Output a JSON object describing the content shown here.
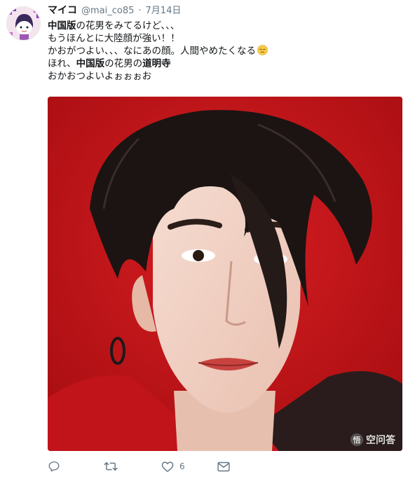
{
  "tweet": {
    "display_name": "マイコ",
    "handle": "@mai_co85",
    "separator": "·",
    "date": "7月14日",
    "lines": [
      {
        "parts": [
          {
            "t": "中国版",
            "bold": true
          },
          {
            "t": "の花男をみてるけど、、、",
            "bold": false
          }
        ]
      },
      {
        "parts": [
          {
            "t": "もうほんとに大陸顔が強い！！",
            "bold": false
          }
        ]
      },
      {
        "parts": [
          {
            "t": "かおがつよい、、、なにあの顔。人間やめたくなる",
            "bold": false
          }
        ]
      },
      {
        "parts": [
          {
            "t": "ほれ、",
            "bold": false
          },
          {
            "t": "中国版",
            "bold": true
          },
          {
            "t": "の花男の",
            "bold": false
          },
          {
            "t": "道明寺",
            "bold": true
          }
        ]
      },
      {
        "parts": [
          {
            "t": "おかおつよいよぉぉぉお",
            "bold": false
          }
        ]
      }
    ],
    "emoji_icon": "pensive-face-emoji"
  },
  "actions": {
    "reply_icon": "reply-icon",
    "retweet_icon": "retweet-icon",
    "like_icon": "heart-icon",
    "like_count": "6",
    "dm_icon": "envelope-icon"
  },
  "watermark": {
    "badge": "悟",
    "text": "空问答"
  },
  "colors": {
    "text": "#14171a",
    "secondary": "#657786",
    "photo_background": "#c9151a"
  }
}
